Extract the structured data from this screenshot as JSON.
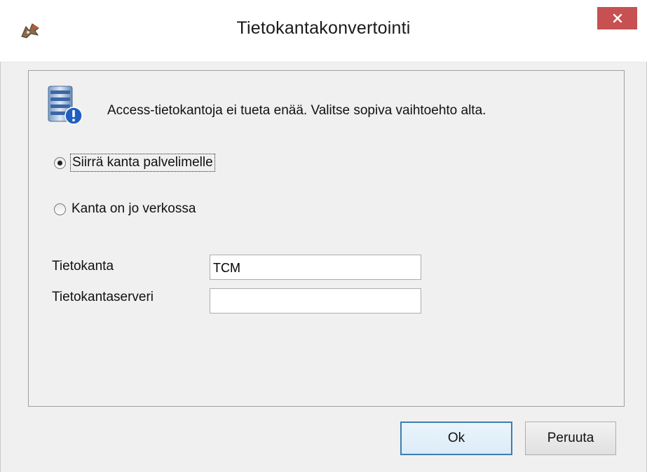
{
  "window": {
    "title": "Tietokantakonvertointi"
  },
  "icons": {
    "app": "app-logo-icon",
    "info": "database-info-icon",
    "close": "close-icon"
  },
  "colors": {
    "close_button": "#c75050",
    "focus_border": "#3c7fb1"
  },
  "message": "Access-tietokantoja ei tueta enää. Valitse sopiva vaihtoehto alta.",
  "options": [
    {
      "label": "Siirrä kanta palvelimelle",
      "selected": true
    },
    {
      "label": "Kanta on jo verkossa",
      "selected": false
    }
  ],
  "fields": {
    "database": {
      "label": "Tietokanta",
      "value": "TCM"
    },
    "server": {
      "label": "Tietokantaserveri",
      "value": ""
    }
  },
  "buttons": {
    "ok": "Ok",
    "cancel": "Peruuta"
  }
}
